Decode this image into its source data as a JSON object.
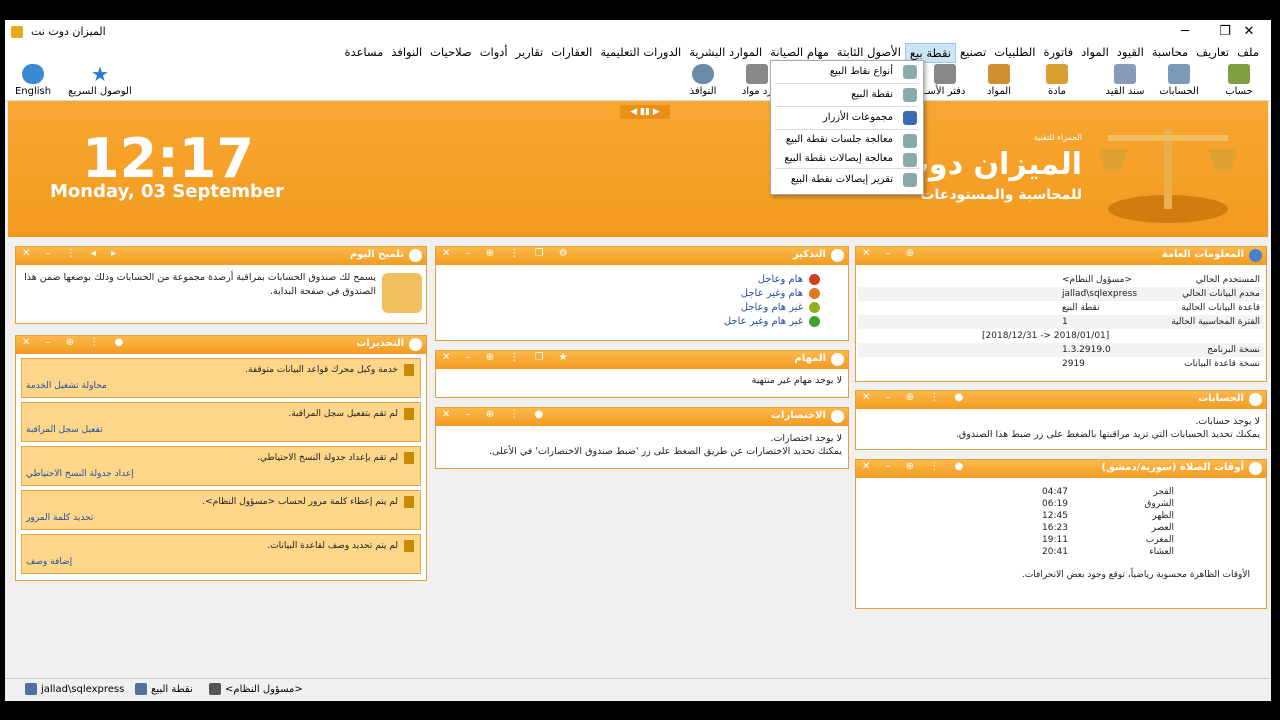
{
  "window": {
    "title": "الميزان دوت نت",
    "minimize": "─",
    "maximize": "❐",
    "close": "✕"
  },
  "menu": [
    "ملف",
    "تعاريف",
    "محاسبة",
    "القيود",
    "المواد",
    "فاتورة",
    "الطلبيات",
    "تصنيع",
    "نقطة بيع",
    "الأصول الثابتة",
    "مهام الصيانة",
    "الموارد البشرية",
    "الدورات التعليمية",
    "العقارات",
    "تقارير",
    "أدوات",
    "صلاحيات",
    "النوافذ",
    "مساعدة"
  ],
  "toolbar": {
    "english": "English",
    "quick": "الوصول السريع",
    "windows": "النوافذ",
    "mat": "رد مواد",
    "ledger": "دفتر الأسـ",
    "materials": "المواد",
    "material": "مادة",
    "entry": "سند القيد",
    "accounts": "الحسابات",
    "account": "حساب"
  },
  "dropdown": [
    "أنواع نقاط البيع",
    "نقطة البيع",
    "مجموعات الأزرار",
    "معالجة جلسات نقطة البيع",
    "معالجة إيصالات نقطة البيع",
    "تقرير إيصالات نقطة البيع"
  ],
  "banner": {
    "time": "12:17",
    "date": "Monday, 03 September",
    "brand_small": "الحمراء للتقنية",
    "brand": "الميزان دوت نت",
    "tagline": "للمحاسبة والمستودعات"
  },
  "tip": {
    "title": "تلميح اليوم",
    "text": "يسمح لك صندوق الحسابات بمراقبة أرصدة مجموعة من الحسابات وذلك بوضعها ضمن هذا الصندوق في صفحة البداية."
  },
  "warnings": {
    "title": "التحذيرات",
    "items": [
      {
        "text": "خدمة وكيل محرك قواعد البيانات متوقفة.",
        "link": "محاولة تشغيل الخدمة"
      },
      {
        "text": "لم تقم بتفعيل سجل المراقبة.",
        "link": "تفعيل سجل المراقبة"
      },
      {
        "text": "لم تقم بإعداد جدولة النسخ الاحتياطي.",
        "link": "إعداد جدولة النسخ الاحتياطي"
      },
      {
        "text": "لم يتم إعطاء كلمة مرور لحساب <مسؤول النظام>.",
        "link": "تحديد كلمة المرور"
      },
      {
        "text": "لم يتم تحديد وصف لقاعدة البيانات.",
        "link": "إضافة وصف"
      }
    ]
  },
  "reminders": {
    "title": "التذكير",
    "items": [
      "هام وعاجل",
      "هام وغير عاجل",
      "غير هام وعاجل",
      "غير هام وغير عاجل"
    ],
    "colors": [
      "#d04020",
      "#e07a20",
      "#90b020",
      "#40a030"
    ]
  },
  "tasks": {
    "title": "المهام",
    "text": "لا يوجد مهام غير منتهية"
  },
  "shortcuts": {
    "title": "الاختصارات",
    "line1": "لا يوجد اختصارات.",
    "line2": "يمكنك تحديد الاختصارات عن طريق الضغط على زر 'ضبط صندوق الاختصارات' في الأعلى."
  },
  "info": {
    "title": "المعلومات العامة",
    "rows": [
      {
        "k": "المستخدم الحالي",
        "v": "<مسؤول النظام>"
      },
      {
        "k": "مخدم البيانات الحالي",
        "v": "jallad\\sqlexpress"
      },
      {
        "k": "قاعدة البيانات الحالية",
        "v": "نقطة البيع"
      },
      {
        "k": "الفترة المحاسبية الحالية",
        "v": "1"
      },
      {
        "k": "",
        "v": "[2018/12/31 -> 2018/01/01]"
      },
      {
        "k": "نسخة البرنامج",
        "v": "1.3.2919.0"
      },
      {
        "k": "نسخة قاعدة البيانات",
        "v": "2919"
      }
    ]
  },
  "accounts": {
    "title": "الحسابات",
    "line1": "لا يوجد حسابات.",
    "line2": "يمكنك تحديد الحسابات التي تريد مراقبتها بالضغط على زر ضبط هذا الصندوق."
  },
  "prayer": {
    "title": "أوقات الصلاة (سورية/دمشق)",
    "rows": [
      {
        "k": "الفجر",
        "v": "04:47"
      },
      {
        "k": "الشروق",
        "v": "06:19"
      },
      {
        "k": "الظهر",
        "v": "12:45"
      },
      {
        "k": "العصر",
        "v": "16:23"
      },
      {
        "k": "المغرب",
        "v": "19:11"
      },
      {
        "k": "العشاء",
        "v": "20:41"
      }
    ],
    "note": "الأوقات الظاهرة محسوبة رياضياً، توقع وجود بعض الانحرافات."
  },
  "status": {
    "server": "jallad\\sqlexpress",
    "db": "نقطة البيع",
    "user": "<مسؤول النظام>"
  }
}
